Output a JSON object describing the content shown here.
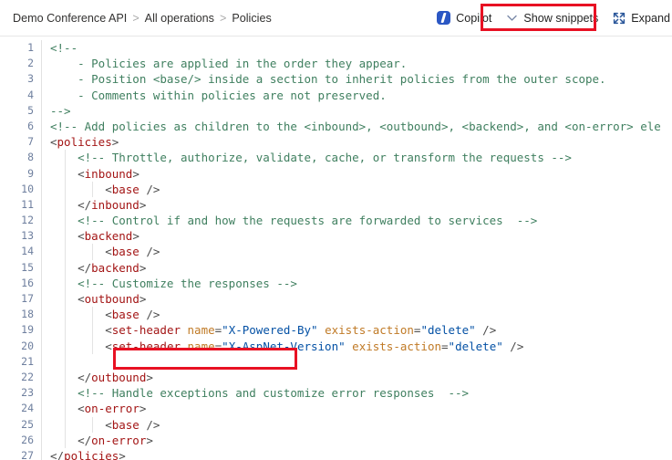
{
  "breadcrumb": {
    "separator": ">",
    "items": [
      {
        "label": "Demo Conference API"
      },
      {
        "label": "All operations"
      },
      {
        "label": "Policies"
      }
    ]
  },
  "toolbar": {
    "copilot_label": "Copilot",
    "copilot_icon": "copilot-icon",
    "show_snippets_label": "Show snippets",
    "show_snippets_icon": "chevron-down-icon",
    "expand_label": "Expand",
    "expand_icon": "expand-arrows-icon"
  },
  "annotations": {
    "highlight_color": "#e81123",
    "boxes": [
      {
        "name": "show-snippets-highlight",
        "target": "Show snippets"
      },
      {
        "name": "line-21-highlight",
        "target": "line 21"
      }
    ]
  },
  "editor": {
    "language": "xml",
    "first_line": 1,
    "last_line": 27,
    "lines": [
      {
        "n": "1",
        "tokens": [
          {
            "c": "com",
            "t": "<!--"
          }
        ]
      },
      {
        "n": "2",
        "tokens": [
          {
            "c": "com",
            "t": "    - Policies are applied in the order they appear."
          }
        ]
      },
      {
        "n": "3",
        "tokens": [
          {
            "c": "com",
            "t": "    - Position <base/> inside a section to inherit policies from the outer scope."
          }
        ]
      },
      {
        "n": "4",
        "tokens": [
          {
            "c": "com",
            "t": "    - Comments within policies are not preserved."
          }
        ]
      },
      {
        "n": "5",
        "tokens": [
          {
            "c": "com",
            "t": "-->"
          }
        ]
      },
      {
        "n": "6",
        "tokens": [
          {
            "c": "com",
            "t": "<!-- Add policies as children to the <inbound>, <outbound>, <backend>, and <on-error> ele"
          }
        ]
      },
      {
        "n": "7",
        "tokens": [
          {
            "c": "pun",
            "t": "<"
          },
          {
            "c": "tag",
            "t": "policies"
          },
          {
            "c": "pun",
            "t": ">"
          }
        ]
      },
      {
        "n": "8",
        "tokens": [
          {
            "c": "com",
            "t": "    <!-- Throttle, authorize, validate, cache, or transform the requests -->"
          }
        ]
      },
      {
        "n": "9",
        "tokens": [
          {
            "c": "pun",
            "t": "    <"
          },
          {
            "c": "tag",
            "t": "inbound"
          },
          {
            "c": "pun",
            "t": ">"
          }
        ]
      },
      {
        "n": "10",
        "tokens": [
          {
            "c": "pun",
            "t": "        <"
          },
          {
            "c": "tag",
            "t": "base"
          },
          {
            "c": "pun",
            "t": " />"
          }
        ]
      },
      {
        "n": "11",
        "tokens": [
          {
            "c": "pun",
            "t": "    </"
          },
          {
            "c": "tag",
            "t": "inbound"
          },
          {
            "c": "pun",
            "t": ">"
          }
        ]
      },
      {
        "n": "12",
        "tokens": [
          {
            "c": "com",
            "t": "    <!-- Control if and how the requests are forwarded to services  -->"
          }
        ]
      },
      {
        "n": "13",
        "tokens": [
          {
            "c": "pun",
            "t": "    <"
          },
          {
            "c": "tag",
            "t": "backend"
          },
          {
            "c": "pun",
            "t": ">"
          }
        ]
      },
      {
        "n": "14",
        "tokens": [
          {
            "c": "pun",
            "t": "        <"
          },
          {
            "c": "tag",
            "t": "base"
          },
          {
            "c": "pun",
            "t": " />"
          }
        ]
      },
      {
        "n": "15",
        "tokens": [
          {
            "c": "pun",
            "t": "    </"
          },
          {
            "c": "tag",
            "t": "backend"
          },
          {
            "c": "pun",
            "t": ">"
          }
        ]
      },
      {
        "n": "16",
        "tokens": [
          {
            "c": "com",
            "t": "    <!-- Customize the responses -->"
          }
        ]
      },
      {
        "n": "17",
        "tokens": [
          {
            "c": "pun",
            "t": "    <"
          },
          {
            "c": "tag",
            "t": "outbound"
          },
          {
            "c": "pun",
            "t": ">"
          }
        ]
      },
      {
        "n": "18",
        "tokens": [
          {
            "c": "pun",
            "t": "        <"
          },
          {
            "c": "tag",
            "t": "base"
          },
          {
            "c": "pun",
            "t": " />"
          }
        ]
      },
      {
        "n": "19",
        "tokens": [
          {
            "c": "pun",
            "t": "        <"
          },
          {
            "c": "tag",
            "t": "set-header"
          },
          {
            "c": "txt",
            "t": " "
          },
          {
            "c": "att",
            "t": "name"
          },
          {
            "c": "pun",
            "t": "="
          },
          {
            "c": "val",
            "t": "\"X-Powered-By\""
          },
          {
            "c": "txt",
            "t": " "
          },
          {
            "c": "att",
            "t": "exists-action"
          },
          {
            "c": "pun",
            "t": "="
          },
          {
            "c": "val",
            "t": "\"delete\""
          },
          {
            "c": "pun",
            "t": " />"
          }
        ]
      },
      {
        "n": "20",
        "tokens": [
          {
            "c": "pun",
            "t": "        <"
          },
          {
            "c": "tag",
            "t": "set-header"
          },
          {
            "c": "txt",
            "t": " "
          },
          {
            "c": "att",
            "t": "name"
          },
          {
            "c": "pun",
            "t": "="
          },
          {
            "c": "val",
            "t": "\"X-AspNet-Version\""
          },
          {
            "c": "txt",
            "t": " "
          },
          {
            "c": "att",
            "t": "exists-action"
          },
          {
            "c": "pun",
            "t": "="
          },
          {
            "c": "val",
            "t": "\"delete\""
          },
          {
            "c": "pun",
            "t": " />"
          }
        ]
      },
      {
        "n": "21",
        "tokens": [
          {
            "c": "txt",
            "t": ""
          }
        ]
      },
      {
        "n": "22",
        "tokens": [
          {
            "c": "pun",
            "t": "    </"
          },
          {
            "c": "tag",
            "t": "outbound"
          },
          {
            "c": "pun",
            "t": ">"
          }
        ]
      },
      {
        "n": "23",
        "tokens": [
          {
            "c": "com",
            "t": "    <!-- Handle exceptions and customize error responses  -->"
          }
        ]
      },
      {
        "n": "24",
        "tokens": [
          {
            "c": "pun",
            "t": "    <"
          },
          {
            "c": "tag",
            "t": "on-error"
          },
          {
            "c": "pun",
            "t": ">"
          }
        ]
      },
      {
        "n": "25",
        "tokens": [
          {
            "c": "pun",
            "t": "        <"
          },
          {
            "c": "tag",
            "t": "base"
          },
          {
            "c": "pun",
            "t": " />"
          }
        ]
      },
      {
        "n": "26",
        "tokens": [
          {
            "c": "pun",
            "t": "    </"
          },
          {
            "c": "tag",
            "t": "on-error"
          },
          {
            "c": "pun",
            "t": ">"
          }
        ]
      },
      {
        "n": "27",
        "tokens": [
          {
            "c": "pun",
            "t": "</"
          },
          {
            "c": "tag",
            "t": "policies"
          },
          {
            "c": "pun",
            "t": ">"
          }
        ]
      }
    ],
    "indent_guides": {
      "lines_with_level1": [
        "8",
        "9",
        "10",
        "11",
        "12",
        "13",
        "14",
        "15",
        "16",
        "17",
        "18",
        "19",
        "20",
        "21",
        "22",
        "23",
        "24",
        "25",
        "26"
      ],
      "lines_with_level2": [
        "10",
        "14",
        "18",
        "19",
        "20",
        "25"
      ]
    }
  }
}
